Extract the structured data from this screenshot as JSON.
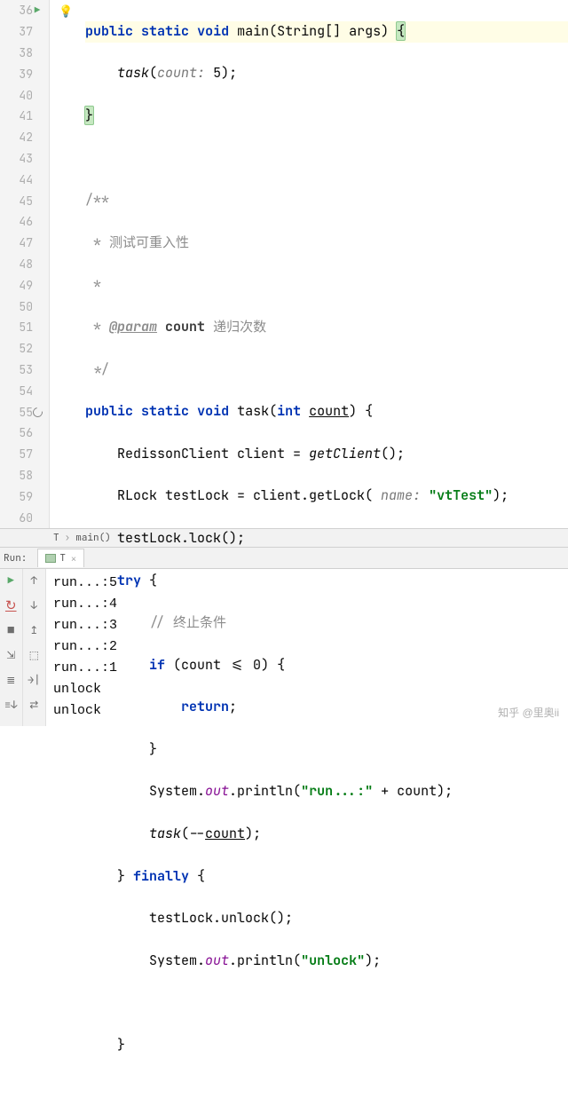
{
  "gutter": {
    "start": 36,
    "end": 60,
    "run_icon_line": 36,
    "bulb_line": 36,
    "recursion_line": 55
  },
  "code": {
    "l36": {
      "kw1": "public",
      "kw2": "static",
      "kw3": "void",
      "method": "main",
      "args": "(String[] args) ",
      "br": "{"
    },
    "l37": {
      "call": "task",
      "hint": "count:",
      "hintval": " 5",
      "rest": ");"
    },
    "l38": {
      "br": "}"
    },
    "l40": {
      "t": "/**"
    },
    "l41": {
      "star": " * ",
      "t": "测试可重入性"
    },
    "l42": {
      "t": " *"
    },
    "l43": {
      "star": " * ",
      "tag": "@param",
      "name": "count",
      "desc": " 递归次数"
    },
    "l44": {
      "t": " */"
    },
    "l45": {
      "kw1": "public",
      "kw2": "static",
      "kw3": "void",
      "method": " task(",
      "kw4": "int",
      "arg": "count",
      "rest": ") {"
    },
    "l46": {
      "t": "RedissonClient client = ",
      "ital": "getClient",
      "rest": "();"
    },
    "l47": {
      "t": "RLock testLock = client.getLock(",
      "hint": " name:",
      "str": "\"vtTest\"",
      "rest": ");"
    },
    "l48": {
      "t": "testLock.lock();"
    },
    "l49": {
      "kw": "try",
      "rest": " {"
    },
    "l50": {
      "c": "// 终止条件"
    },
    "l51": {
      "kw1": "if",
      "mid": " (count <= ",
      "num": "0",
      "rest": ") {"
    },
    "l52": {
      "kw": "return",
      "rest": ";"
    },
    "l53": {
      "t": "}"
    },
    "l54": {
      "a": "System.",
      "b": "out",
      "c": ".println(",
      "str": "\"run...:\"",
      "d": " + count);"
    },
    "l55": {
      "ital": "task",
      "rest": "(--",
      "u": "count",
      "rest2": ");"
    },
    "l56": {
      "a": "} ",
      "kw": "finally",
      "rest": " {"
    },
    "l57": {
      "t": "testLock.unlock();"
    },
    "l58": {
      "a": "System.",
      "b": "out",
      "c": ".println(",
      "str": "\"unlock\"",
      "d": ");"
    },
    "l60": {
      "t": "}"
    }
  },
  "breadcrumb": {
    "items": [
      "T",
      "main()"
    ]
  },
  "run_panel": {
    "label": "Run:",
    "tab_name": "T",
    "output": [
      "run...:5",
      "run...:4",
      "run...:3",
      "run...:2",
      "run...:1",
      "unlock",
      "unlock"
    ]
  },
  "watermark": "知乎 @里奥ii"
}
